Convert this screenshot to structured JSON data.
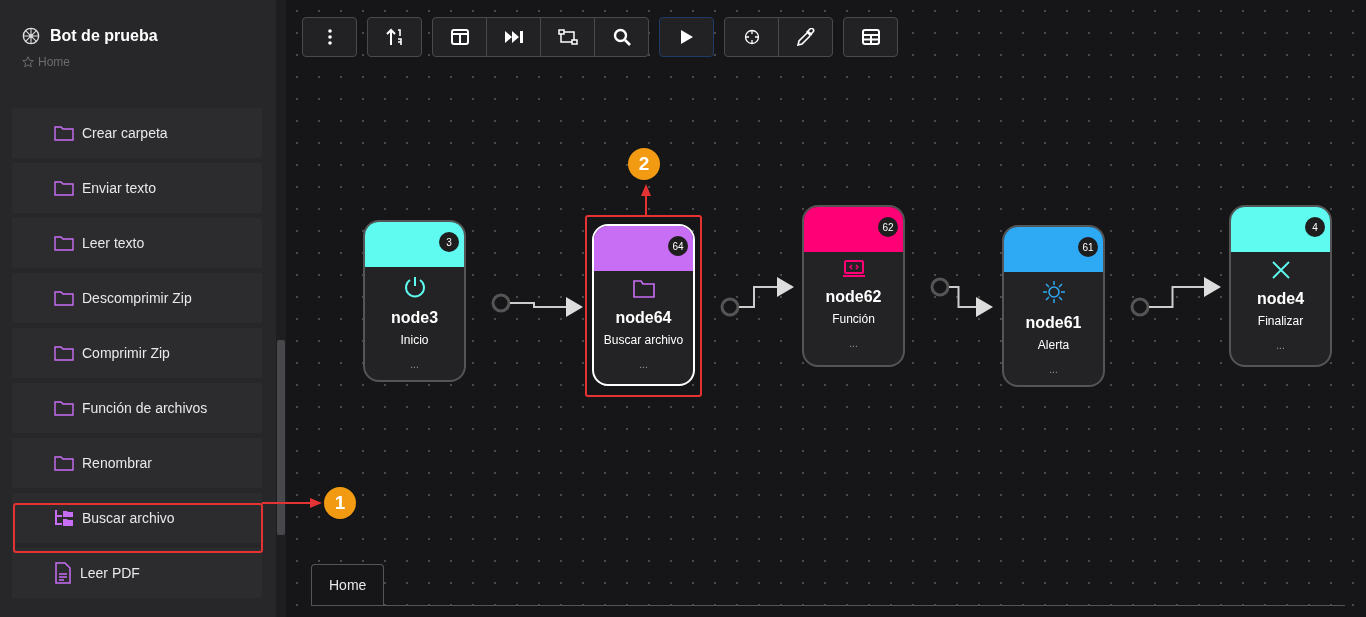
{
  "app": {
    "title": "Bot de prueba",
    "breadcrumb": "Home"
  },
  "sidebar": {
    "items": [
      {
        "label": "Crear carpeta",
        "kind": "folder"
      },
      {
        "label": "Enviar texto",
        "kind": "folder"
      },
      {
        "label": "Leer texto",
        "kind": "folder"
      },
      {
        "label": "Descomprimir Zip",
        "kind": "folder"
      },
      {
        "label": "Comprimir Zip",
        "kind": "folder"
      },
      {
        "label": "Función de archivos",
        "kind": "folder"
      },
      {
        "label": "Renombrar",
        "kind": "folder"
      },
      {
        "label": "Buscar archivo",
        "kind": "tree"
      },
      {
        "label": "Leer PDF",
        "kind": "document"
      }
    ]
  },
  "toolbar": {
    "groups": [
      [
        {
          "kind": "more",
          "active": false
        }
      ],
      [
        {
          "kind": "sort",
          "active": false
        }
      ],
      [
        {
          "kind": "columns",
          "active": false
        },
        {
          "kind": "forward",
          "active": false
        },
        {
          "kind": "nodes",
          "active": false
        },
        {
          "kind": "search",
          "active": false
        }
      ],
      [
        {
          "kind": "play",
          "active": true
        }
      ],
      [
        {
          "kind": "crosshair",
          "active": false
        },
        {
          "kind": "picker",
          "active": false
        }
      ],
      [
        {
          "kind": "table",
          "active": false
        }
      ]
    ]
  },
  "nodes": [
    {
      "badge": "3",
      "name": "node3",
      "label": "Inicio",
      "footer": "...",
      "kind": "power",
      "color": "#5ffbf1",
      "selected": false
    },
    {
      "badge": "64",
      "name": "node64",
      "label": "Buscar archivo",
      "footer": "...",
      "kind": "folder",
      "color": "#c86ef5",
      "selected": true
    },
    {
      "badge": "62",
      "name": "node62",
      "label": "Función",
      "footer": "...",
      "kind": "code",
      "color": "#ff0077",
      "selected": false
    },
    {
      "badge": "61",
      "name": "node61",
      "label": "Alerta",
      "footer": "...",
      "kind": "sun",
      "color": "#2eaaf5",
      "selected": false
    },
    {
      "badge": "4",
      "name": "node4",
      "label": "Finalizar",
      "footer": "...",
      "kind": "close",
      "color": "#5ffbf1",
      "selected": false
    }
  ],
  "annotations": [
    {
      "number": "1"
    },
    {
      "number": "2"
    }
  ],
  "tabs": [
    {
      "label": "Home",
      "selected": true
    }
  ]
}
